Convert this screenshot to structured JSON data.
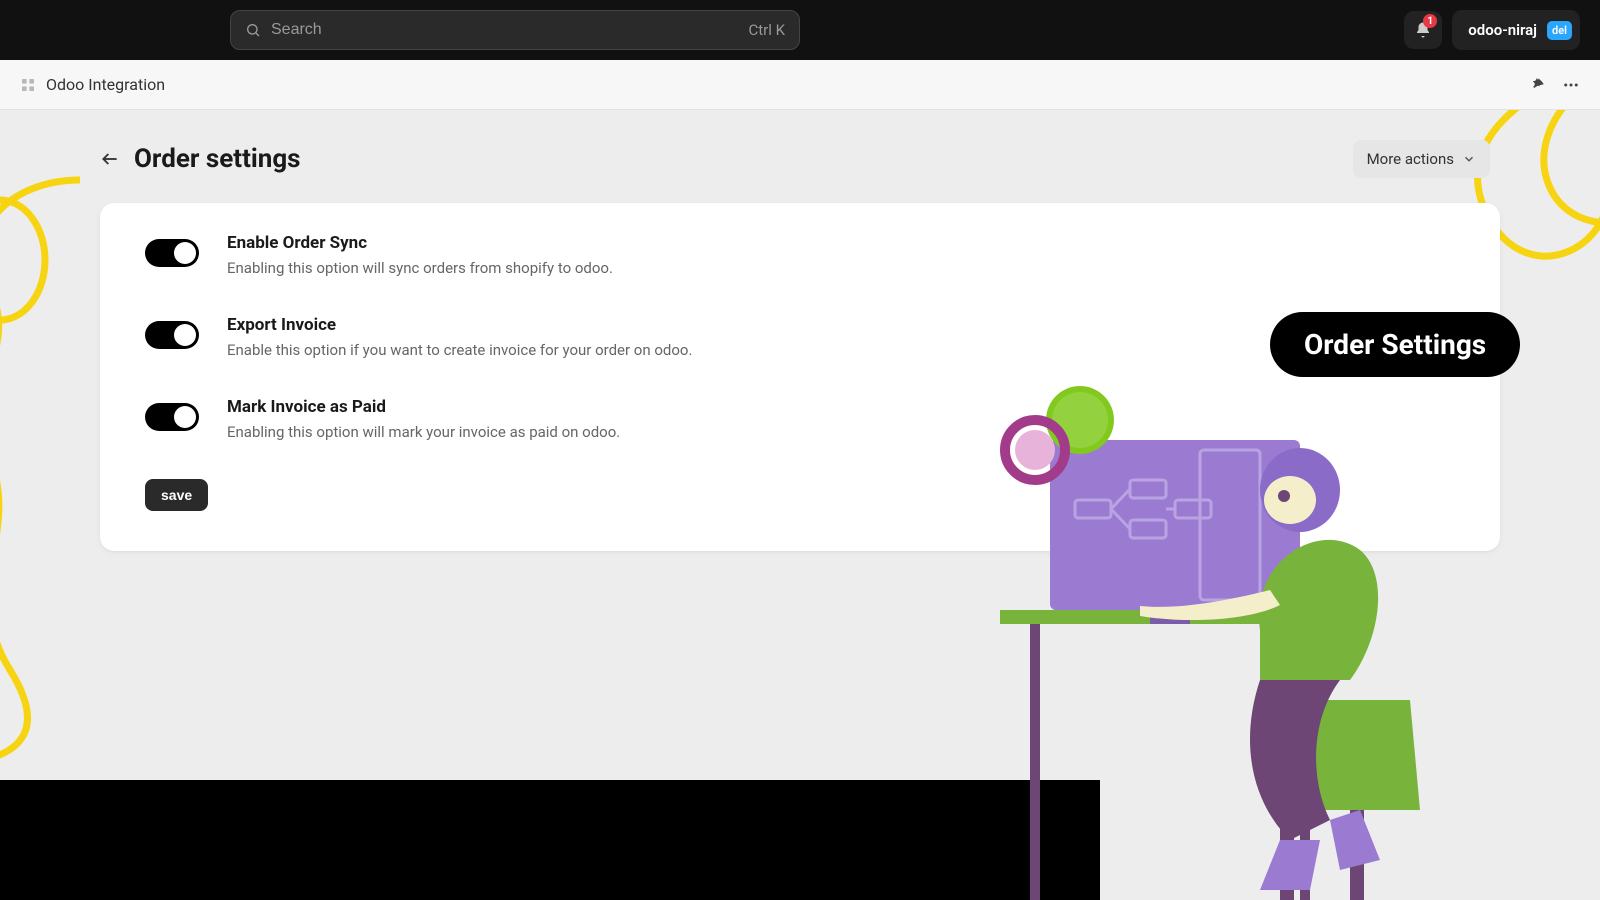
{
  "topbar": {
    "search_placeholder": "Search",
    "search_shortcut": "Ctrl K",
    "notification_count": "1",
    "user_name": "odoo-niraj",
    "user_tag": "del"
  },
  "subheader": {
    "breadcrumb": "Odoo Integration"
  },
  "page": {
    "title": "Order settings",
    "more_actions_label": "More actions"
  },
  "settings": [
    {
      "title": "Enable Order Sync",
      "description": "Enabling this option will sync orders from shopify to odoo.",
      "enabled": true
    },
    {
      "title": "Export Invoice",
      "description": "Enable this option if you want to create invoice for your order on odoo.",
      "enabled": true
    },
    {
      "title": "Mark Invoice as Paid",
      "description": "Enabling this option will mark your invoice as paid on odoo.",
      "enabled": true
    }
  ],
  "save_label": "save",
  "badge_label": "Order Settings"
}
